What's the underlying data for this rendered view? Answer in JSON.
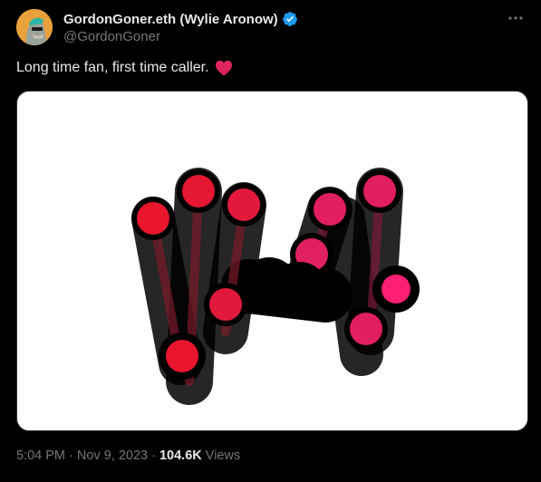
{
  "author": {
    "display_name": "GordonGoner.eth (Wylie Aronow)",
    "handle": "@GordonGoner",
    "verified": true
  },
  "tweet": {
    "text": "Long time fan, first time caller.",
    "emoji": "heart-emoji"
  },
  "media": {
    "description_icon": "abstract-M-logo-image"
  },
  "meta": {
    "time": "5:04 PM",
    "sep1": " · ",
    "date": "Nov 9, 2023",
    "sep2": " · ",
    "views_count": "104.6K",
    "views_label": " Views"
  },
  "colors": {
    "background": "#000000",
    "text_primary": "#e7e9ea",
    "text_secondary": "#71767b",
    "verified_blue": "#1d9bf0",
    "heart_red": "#e0245e"
  }
}
